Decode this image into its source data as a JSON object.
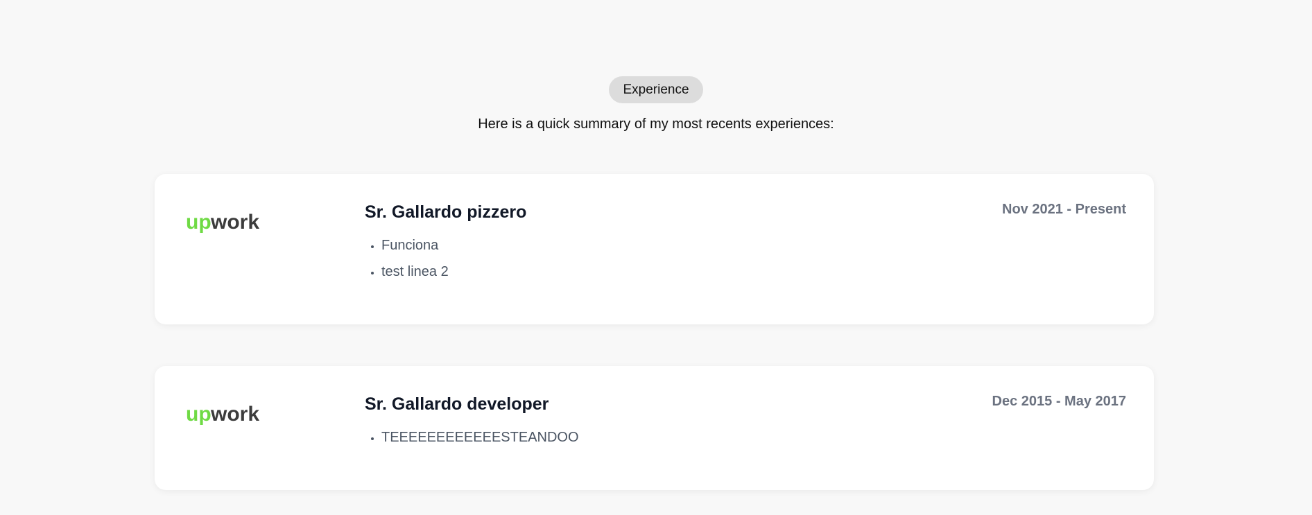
{
  "header": {
    "badge_label": "Experience",
    "subtitle": "Here is a quick summary of my most recents experiences:"
  },
  "experiences": [
    {
      "logo_text_left": "up",
      "logo_text_right": "work",
      "title": "Sr. Gallardo pizzero",
      "dates": "Nov 2021 - Present",
      "bullets": [
        "Funciona",
        "test linea 2"
      ]
    },
    {
      "logo_text_left": "up",
      "logo_text_right": "work",
      "title": "Sr. Gallardo developer",
      "dates": "Dec 2015 - May 2017",
      "bullets": [
        "TEEEEEEEEEEEESTEANDOO"
      ]
    }
  ],
  "colors": {
    "logo_green": "#6fda44",
    "logo_dark": "#3c3c3c",
    "background": "#f8f8f8"
  },
  "icons": {
    "logo": "upwork-logo"
  }
}
